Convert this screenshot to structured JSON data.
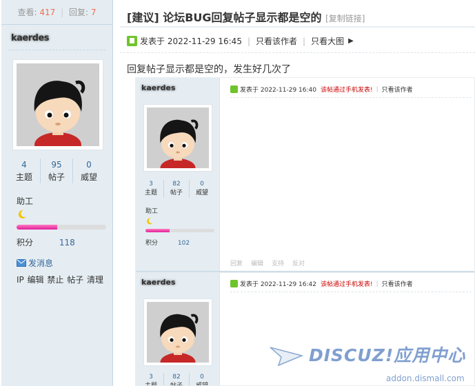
{
  "sidebar": {
    "views_label": "查看:",
    "views": "417",
    "replies_label": "回复:",
    "replies": "7",
    "username": "kaerdes",
    "stats": [
      {
        "value": "4",
        "label": "主题"
      },
      {
        "value": "95",
        "label": "帖子"
      },
      {
        "value": "0",
        "label": "威望"
      }
    ],
    "rank": "助工",
    "rank_progress": 0.45,
    "credit_label": "积分",
    "credit_value": "118",
    "send_message": "发消息",
    "tools": "IP 编辑 禁止 帖子 清理"
  },
  "post": {
    "title": "[建议] 论坛BUG回复帖子显示都是空的",
    "copy_link": "[复制链接]",
    "posted_at": "发表于 2022-11-29 16:45",
    "only_author": "只看该作者",
    "big_image": "只看大图",
    "content": "回复帖子显示都是空的，发生好几次了"
  },
  "embed": {
    "posts": [
      {
        "username": "kaerdes",
        "stats": [
          {
            "value": "3",
            "label": "主题"
          },
          {
            "value": "82",
            "label": "帖子"
          },
          {
            "value": "0",
            "label": "威望"
          }
        ],
        "rank": "助工",
        "rank_progress": 0.35,
        "credit_label": "积分",
        "credit_value": "102",
        "posted_at": "发表于 2022-11-29 16:40",
        "via": "该帖通过手机发表!",
        "only_author": "只看该作者",
        "actions": [
          "回复",
          "编辑",
          "支持",
          "反对"
        ]
      },
      {
        "username": "kaerdes",
        "stats": [
          {
            "value": "3",
            "label": "主题"
          },
          {
            "value": "82",
            "label": "帖子"
          },
          {
            "value": "0",
            "label": "威望"
          }
        ],
        "posted_at": "发表于 2022-11-29 16:42",
        "via": "该帖通过手机发表!",
        "only_author": "只看该作者"
      }
    ]
  },
  "watermark": {
    "brand": "DISCUZ!应用中心",
    "url": "addon.dismall.com"
  },
  "colors": {
    "sidebar_bg": "#e5edf2",
    "link": "#336699",
    "highlight": "#f26c4f",
    "progress": "#e0209a"
  }
}
